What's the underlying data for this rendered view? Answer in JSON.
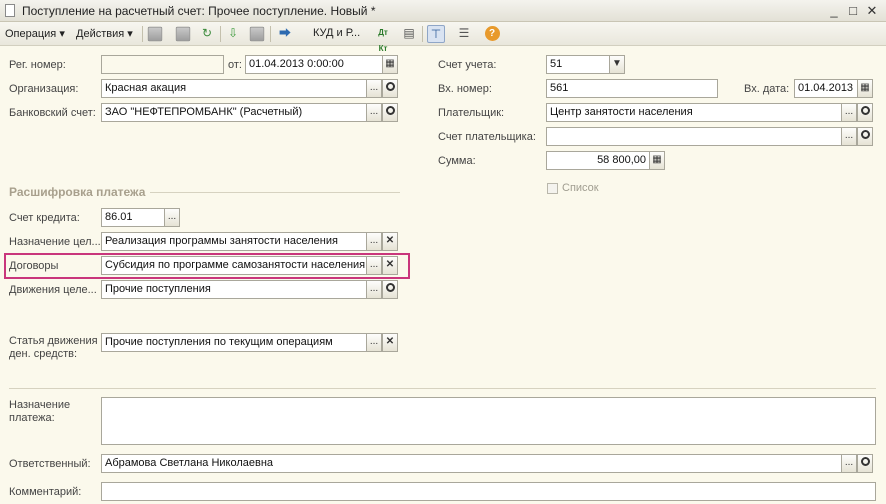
{
  "window": {
    "title": "Поступление на расчетный счет: Прочее поступление. Новый *",
    "btn_minimize": "_",
    "btn_maximize": "□",
    "btn_close": "✕"
  },
  "toolbar": {
    "operation": "Операция",
    "actions": "Действия",
    "kud": "КУД и Р...",
    "dt_kt": "Дт Кт",
    "help": "?"
  },
  "form": {
    "reg_number_label": "Рег. номер:",
    "reg_number_value": "",
    "from_label": "от:",
    "from_value": "01.04.2013  0:00:00",
    "organization_label": "Организация:",
    "organization_value": "Красная акация",
    "bank_account_label": "Банковский счет:",
    "bank_account_value": "ЗАО \"НЕФТЕПРОМБАНК\" (Расчетный)",
    "account_label": "Счет учета:",
    "account_value": "51",
    "in_number_label": "Вх. номер:",
    "in_number_value": "561",
    "in_date_label": "Вх. дата:",
    "in_date_value": "01.04.2013",
    "payer_label": "Плательщик:",
    "payer_value": "Центр занятости населения",
    "payer_account_label": "Счет плательщика:",
    "payer_account_value": "",
    "sum_label": "Сумма:",
    "sum_value": "58 800,00",
    "list_label": "Список"
  },
  "decode": {
    "section_title": "Расшифровка платежа",
    "credit_account_label": "Счет кредита:",
    "credit_account_value": "86.01",
    "purpose_label": "Назначение цел...",
    "purpose_value": "Реализация программы занятости населения",
    "contracts_label": "Договоры",
    "contracts_value": "Субсидия по программе самозанятости населения",
    "movements_label": "Движения целе...",
    "movements_value": "Прочие поступления",
    "cashflow_label": "Статья движения ден. средств:",
    "cashflow_value": "Прочие поступления по текущим операциям"
  },
  "bottom": {
    "payment_purpose_label": "Назначение платежа:",
    "payment_purpose_value": "",
    "responsible_label": "Ответственный:",
    "responsible_value": "Абрамова Светлана Николаевна",
    "comment_label": "Комментарий:",
    "comment_value": ""
  },
  "icons": {
    "ellipsis": "...",
    "clear": "✕",
    "dropdown": "▼",
    "calendar": "▦",
    "calculator": "▦"
  },
  "colors": {
    "highlight": "#c9367c",
    "background": "#fbf9ec"
  }
}
